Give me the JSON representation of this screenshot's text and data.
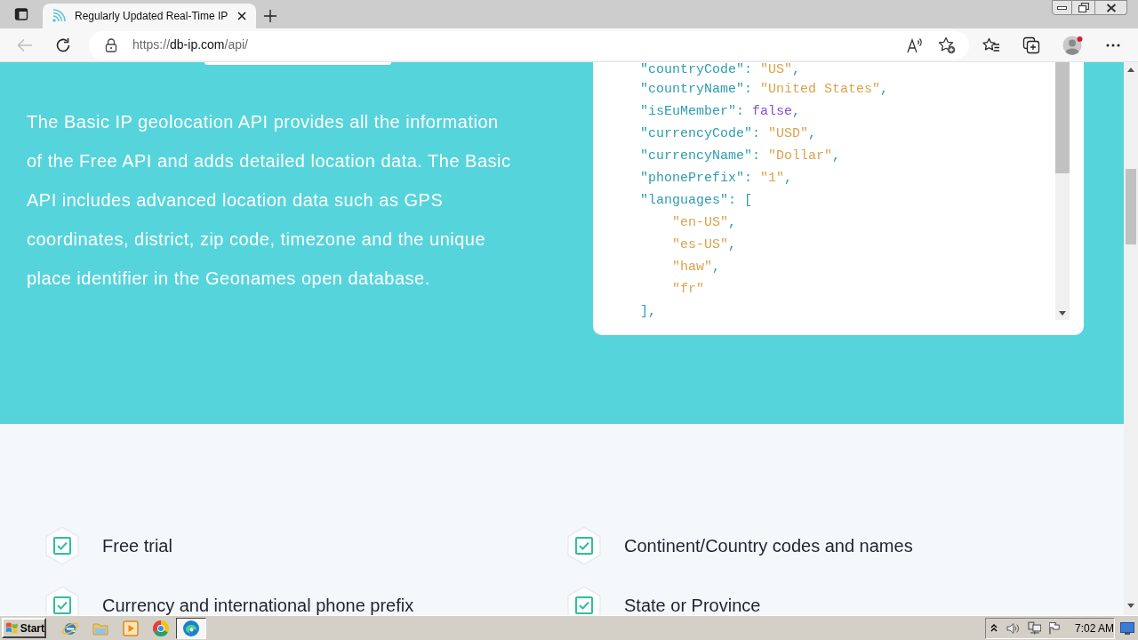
{
  "browser": {
    "tab": {
      "title": "Regularly Updated Real-Time IP",
      "selected": true
    },
    "back_button": {
      "disabled": true
    },
    "address": {
      "scheme": "https://",
      "host": "db-ip.com",
      "path": "/api/"
    }
  },
  "hero": {
    "description": "The Basic IP geolocation API provides all the information of the Free API and adds detailed location data. The Basic API includes advanced location data such as GPS coordinates, district, zip code, timezone and the unique place identifier in the Geonames open database."
  },
  "code_panel": {
    "lines": [
      {
        "tokens": [
          {
            "kind": "key",
            "text": "\"countryCode\""
          },
          {
            "kind": "punct",
            "text": ": "
          },
          {
            "kind": "string",
            "text": "\"US\""
          },
          {
            "kind": "punct",
            "text": ","
          }
        ]
      },
      {
        "tokens": [
          {
            "kind": "key",
            "text": "\"countryName\""
          },
          {
            "kind": "punct",
            "text": ": "
          },
          {
            "kind": "string",
            "text": "\"United States\""
          },
          {
            "kind": "punct",
            "text": ","
          }
        ]
      },
      {
        "tokens": [
          {
            "kind": "key",
            "text": "\"isEuMember\""
          },
          {
            "kind": "punct",
            "text": ": "
          },
          {
            "kind": "boolean",
            "text": "false"
          },
          {
            "kind": "punct",
            "text": ","
          }
        ]
      },
      {
        "tokens": [
          {
            "kind": "key",
            "text": "\"currencyCode\""
          },
          {
            "kind": "punct",
            "text": ": "
          },
          {
            "kind": "string",
            "text": "\"USD\""
          },
          {
            "kind": "punct",
            "text": ","
          }
        ]
      },
      {
        "tokens": [
          {
            "kind": "key",
            "text": "\"currencyName\""
          },
          {
            "kind": "punct",
            "text": ": "
          },
          {
            "kind": "string",
            "text": "\"Dollar\""
          },
          {
            "kind": "punct",
            "text": ","
          }
        ]
      },
      {
        "tokens": [
          {
            "kind": "key",
            "text": "\"phonePrefix\""
          },
          {
            "kind": "punct",
            "text": ": "
          },
          {
            "kind": "string",
            "text": "\"1\""
          },
          {
            "kind": "punct",
            "text": ","
          }
        ]
      },
      {
        "tokens": [
          {
            "kind": "key",
            "text": "\"languages\""
          },
          {
            "kind": "punct",
            "text": ": ["
          }
        ],
        "children": [
          {
            "tokens": [
              {
                "kind": "string",
                "text": "\"en-US\""
              },
              {
                "kind": "punct",
                "text": ","
              }
            ]
          },
          {
            "tokens": [
              {
                "kind": "string",
                "text": "\"es-US\""
              },
              {
                "kind": "punct",
                "text": ","
              }
            ]
          },
          {
            "tokens": [
              {
                "kind": "string",
                "text": "\"haw\""
              },
              {
                "kind": "punct",
                "text": ","
              }
            ]
          },
          {
            "tokens": [
              {
                "kind": "string",
                "text": "\"fr\""
              }
            ]
          }
        ]
      },
      {
        "tokens": [
          {
            "kind": "punct",
            "text": "],"
          }
        ]
      }
    ]
  },
  "features": [
    {
      "label": "Free trial"
    },
    {
      "label": "Continent/Country codes and names"
    },
    {
      "label": "Currency and international phone prefix"
    },
    {
      "label": "State or Province"
    }
  ],
  "taskbar": {
    "start_label": "Start",
    "apps": [
      {
        "kind": "ie",
        "selected": false
      },
      {
        "kind": "explorer",
        "selected": false
      },
      {
        "kind": "media",
        "selected": false
      },
      {
        "kind": "chrome",
        "selected": false
      },
      {
        "kind": "edge",
        "selected": true
      }
    ],
    "clock": "7:02 AM"
  }
}
